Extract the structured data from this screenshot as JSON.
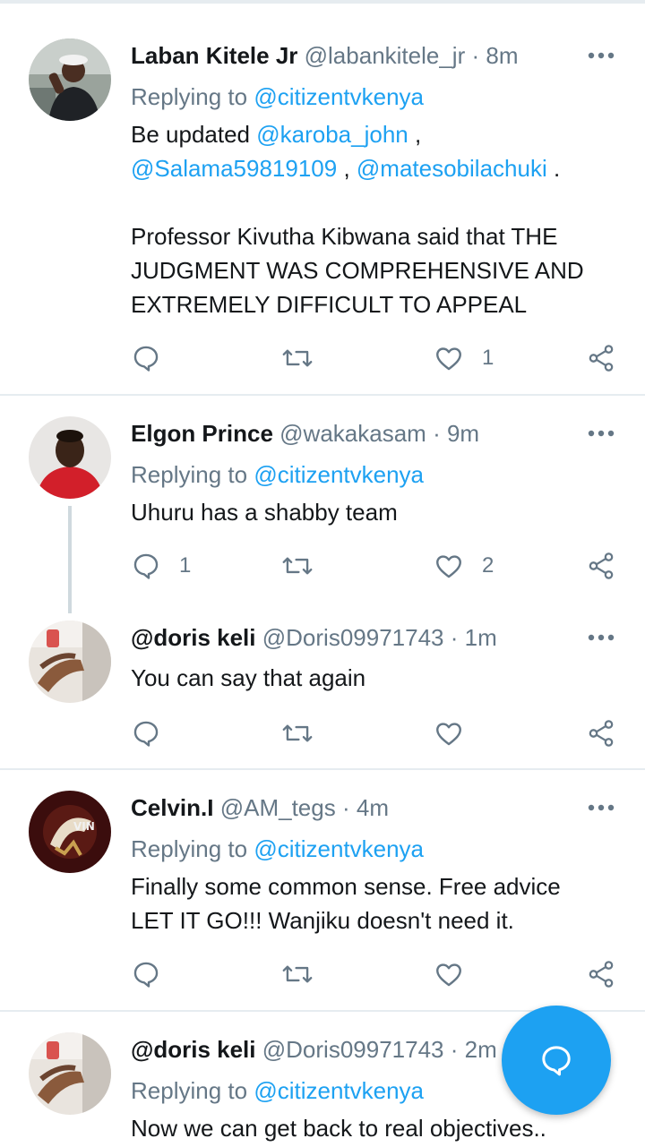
{
  "colors": {
    "accent": "#1da1f2",
    "muted": "#657786",
    "text": "#14171a",
    "divider": "#e6ecf0"
  },
  "tweets": [
    {
      "name": "Laban Kitele Jr",
      "handle": "@labankitele_jr",
      "sep": "·",
      "time": "8m",
      "replying_prefix": "Replying to ",
      "replying_handle": "@citizentvkenya",
      "text_line1_a": "Be updated ",
      "text_line1_mention": "@karoba_john",
      "text_line1_b": " ,",
      "text_line2_mention1": "@Salama59819109",
      "text_line2_mid": " , ",
      "text_line2_mention2": "@matesobilachuki",
      "text_line2_end": " .",
      "text_line4": "Professor Kivutha Kibwana said that THE",
      "text_line5": "JUDGMENT WAS COMPREHENSIVE AND",
      "text_line6": "EXTREMELY DIFFICULT TO APPEAL",
      "reply_count": "",
      "like_count": "1"
    },
    {
      "name": "Elgon Prince",
      "handle": "@wakakasam",
      "sep": "·",
      "time": "9m",
      "replying_prefix": "Replying to ",
      "replying_handle": "@citizentvkenya",
      "text": "Uhuru has a shabby team",
      "reply_count": "1",
      "like_count": "2"
    },
    {
      "name": "@doris keli",
      "handle": "@Doris09971743",
      "sep": "·",
      "time": "1m",
      "text": "You can say that again",
      "reply_count": "",
      "like_count": ""
    },
    {
      "name": "Celvin.I",
      "handle": "@AM_tegs",
      "sep": "·",
      "time": "4m",
      "replying_prefix": "Replying to ",
      "replying_handle": "@citizentvkenya",
      "text_line1": "Finally some common sense. Free advice",
      "text_line2": "LET IT GO!!! Wanjiku doesn't need it.",
      "reply_count": "",
      "like_count": ""
    },
    {
      "name": "@doris keli",
      "handle": "@Doris09971743",
      "sep": "·",
      "time": "2m",
      "replying_prefix": "Replying to ",
      "replying_handle": "@citizentvkenya",
      "text": "Now we can get back to real objectives.."
    }
  ],
  "icons": {
    "reply": "reply-icon",
    "retweet": "retweet-icon",
    "like": "heart-icon",
    "share": "share-icon",
    "more": "more-icon",
    "compose": "compose-reply-icon"
  }
}
